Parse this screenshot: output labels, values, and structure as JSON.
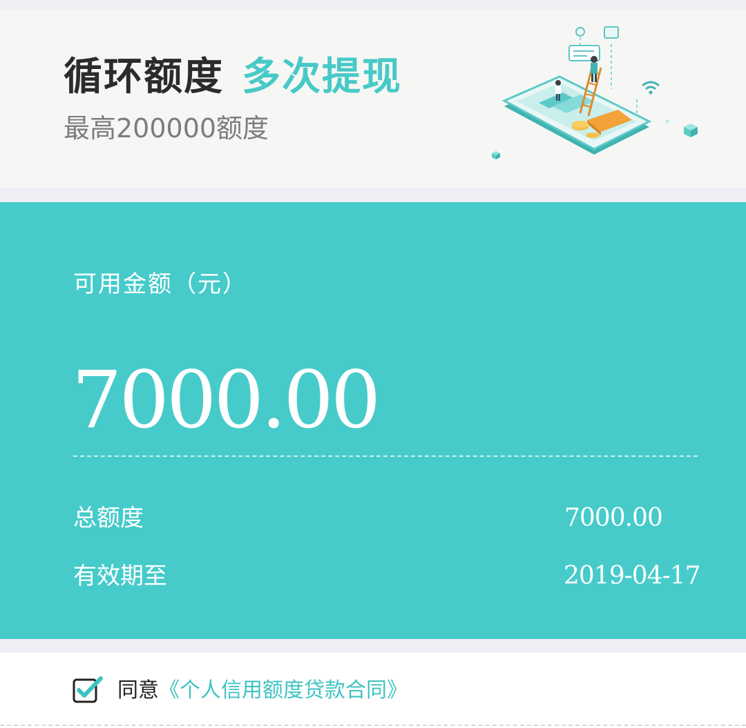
{
  "banner": {
    "title_main": "循环额度",
    "title_accent": "多次提现",
    "subtitle": "最高200000额度",
    "illustration_icon": "phone-ladder-cards-illustration"
  },
  "card": {
    "available_label": "可用金额（元）",
    "available_amount": "7000.00",
    "total_label": "总额度",
    "total_value": "7000.00",
    "expiry_label": "有效期至",
    "expiry_value": "2019-04-17"
  },
  "agreement": {
    "checked": true,
    "checkbox_icon": "checkbox-checked-icon",
    "prefix": "同意",
    "link_text": "《个人信用额度贷款合同》"
  },
  "colors": {
    "accent": "#46cbca",
    "page_bg": "#efeef4",
    "banner_bg": "#f6f7f4",
    "title_dark": "#2b2b2b",
    "subtitle_gray": "#7c7c7c",
    "link": "#3fc3c2"
  }
}
